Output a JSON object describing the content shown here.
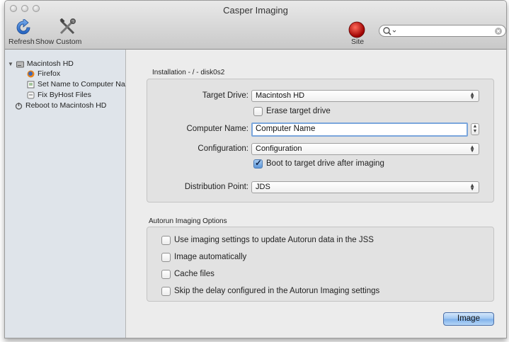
{
  "window": {
    "title": "Casper Imaging"
  },
  "toolbar": {
    "refresh_label": "Refresh",
    "show_custom_label": "Show Custom",
    "site_label": "Site",
    "search_placeholder": ""
  },
  "sidebar": {
    "items": [
      {
        "label": "Macintosh HD",
        "icon": "disk-icon"
      },
      {
        "label": "Firefox",
        "icon": "firefox-icon"
      },
      {
        "label": "Set Name to Computer Na...",
        "icon": "script-icon"
      },
      {
        "label": "Fix ByHost Files",
        "icon": "script-icon"
      },
      {
        "label": "Reboot to Macintosh HD",
        "icon": "power-icon"
      }
    ]
  },
  "installation": {
    "group_label": "Installation - / - disk0s2",
    "target_drive_label": "Target Drive:",
    "target_drive_value": "Macintosh HD",
    "erase_label": "Erase target drive",
    "erase_checked": false,
    "computer_name_label": "Computer Name:",
    "computer_name_value": "Computer Name",
    "configuration_label": "Configuration:",
    "configuration_value": "Configuration",
    "boot_label": "Boot to target drive after imaging",
    "boot_checked": true,
    "distribution_label": "Distribution Point:",
    "distribution_value": "JDS"
  },
  "autorun": {
    "group_label": "Autorun Imaging Options",
    "options": [
      {
        "label": "Use imaging settings to update Autorun data in the JSS",
        "checked": false
      },
      {
        "label": "Image automatically",
        "checked": false
      },
      {
        "label": "Cache files",
        "checked": false
      },
      {
        "label": "Skip the delay configured in the Autorun Imaging settings",
        "checked": false
      }
    ]
  },
  "image_button_label": "Image"
}
